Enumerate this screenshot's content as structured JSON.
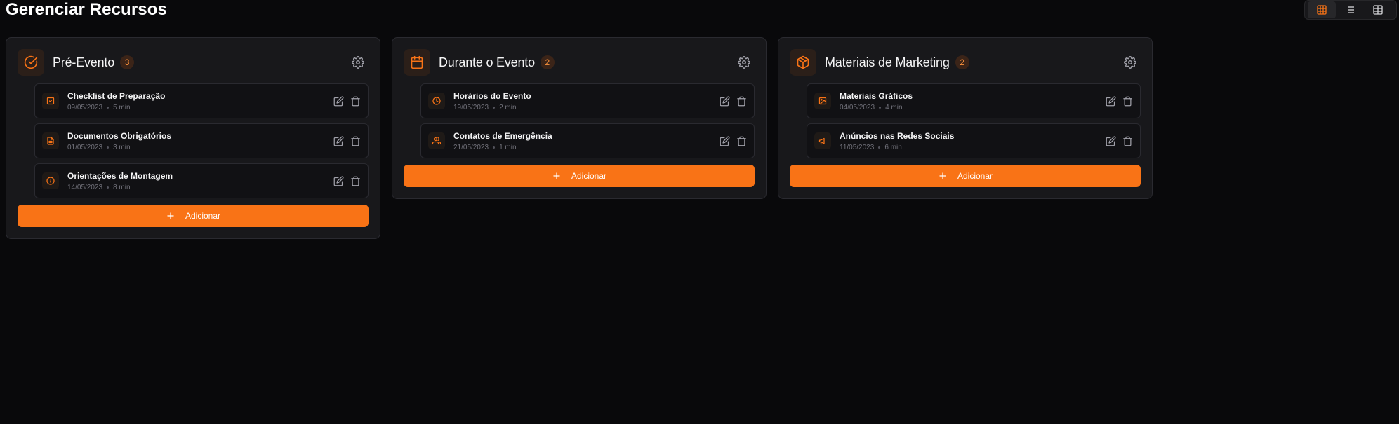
{
  "page": {
    "title": "Gerenciar Recursos"
  },
  "view_toggle": {
    "active": "grid",
    "options": [
      {
        "icon": "grid-icon"
      },
      {
        "icon": "list-icon"
      },
      {
        "icon": "table-icon"
      }
    ]
  },
  "colors": {
    "accent": "#f97316",
    "background": "#09090b",
    "card": "#18181b"
  },
  "columns": [
    {
      "title": "Pré-Evento",
      "count": "3",
      "icon": "check-circle-icon",
      "add_label": "Adicionar",
      "items": [
        {
          "title": "Checklist de Preparação",
          "date": "09/05/2023",
          "duration": "5 min",
          "icon": "check-square-icon"
        },
        {
          "title": "Documentos Obrigatórios",
          "date": "01/05/2023",
          "duration": "3 min",
          "icon": "file-text-icon"
        },
        {
          "title": "Orientações de Montagem",
          "date": "14/05/2023",
          "duration": "8 min",
          "icon": "info-icon"
        }
      ]
    },
    {
      "title": "Durante o Evento",
      "count": "2",
      "icon": "calendar-icon",
      "add_label": "Adicionar",
      "items": [
        {
          "title": "Horários do Evento",
          "date": "19/05/2023",
          "duration": "2 min",
          "icon": "clock-icon"
        },
        {
          "title": "Contatos de Emergência",
          "date": "21/05/2023",
          "duration": "1 min",
          "icon": "users-icon"
        }
      ]
    },
    {
      "title": "Materiais de Marketing",
      "count": "2",
      "icon": "package-icon",
      "add_label": "Adicionar",
      "items": [
        {
          "title": "Materiais Gráficos",
          "date": "04/05/2023",
          "duration": "4 min",
          "icon": "image-icon"
        },
        {
          "title": "Anúncios nas Redes Sociais",
          "date": "11/05/2023",
          "duration": "6 min",
          "icon": "megaphone-icon"
        }
      ]
    }
  ]
}
